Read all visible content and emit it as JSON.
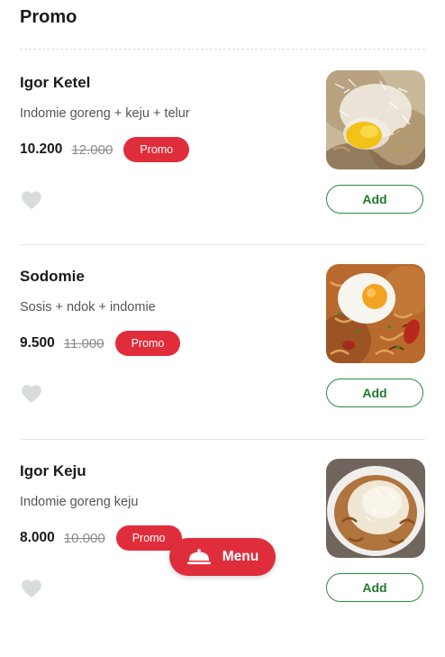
{
  "section": {
    "title": "Promo"
  },
  "items": [
    {
      "name": "Igor Ketel",
      "description": "Indomie goreng + keju + telur",
      "price": "10.200",
      "old_price": "12.000",
      "badge": "Promo",
      "add_label": "Add",
      "image_icon": "noodles-cheese-egg-photo"
    },
    {
      "name": "Sodomie",
      "description": "Sosis + ndok + indomie",
      "price": "9.500",
      "old_price": "11.000",
      "badge": "Promo",
      "add_label": "Add",
      "image_icon": "noodles-fried-egg-sausage-photo"
    },
    {
      "name": "Igor Keju",
      "description": "Indomie goreng keju",
      "price": "8.000",
      "old_price": "10.000",
      "badge": "Promo",
      "add_label": "Add",
      "image_icon": "noodles-grated-cheese-photo"
    }
  ],
  "fab": {
    "label": "Menu",
    "icon": "cloche-icon"
  },
  "colors": {
    "promo_red": "#e02d3c",
    "add_green": "#2e8b3a",
    "heart_gray": "#d9dcdd"
  }
}
